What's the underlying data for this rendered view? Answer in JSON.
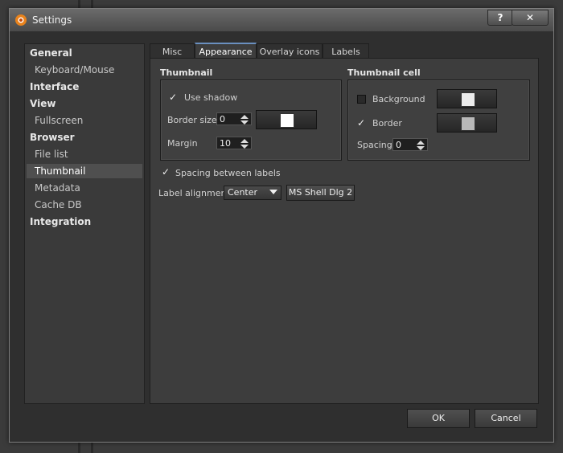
{
  "window": {
    "title": "Settings",
    "help_label": "?",
    "close_label": "✕"
  },
  "sidebar": {
    "items": [
      {
        "label": "General",
        "type": "header"
      },
      {
        "label": "Keyboard/Mouse",
        "type": "sub"
      },
      {
        "label": "Interface",
        "type": "header"
      },
      {
        "label": "View",
        "type": "header"
      },
      {
        "label": "Fullscreen",
        "type": "sub"
      },
      {
        "label": "Browser",
        "type": "header"
      },
      {
        "label": "File list",
        "type": "sub"
      },
      {
        "label": "Thumbnail",
        "type": "sub",
        "selected": true
      },
      {
        "label": "Metadata",
        "type": "sub"
      },
      {
        "label": "Cache DB",
        "type": "sub"
      },
      {
        "label": "Integration",
        "type": "header"
      }
    ]
  },
  "tabs": [
    {
      "label": "Misc"
    },
    {
      "label": "Appearance",
      "active": true
    },
    {
      "label": "Overlay icons"
    },
    {
      "label": "Labels"
    }
  ],
  "thumbnail": {
    "title": "Thumbnail",
    "use_shadow_label": "Use shadow",
    "use_shadow_checked": true,
    "border_size_label": "Border size",
    "border_size_value": "0",
    "border_color": "#ffffff",
    "margin_label": "Margin",
    "margin_value": "10"
  },
  "thumbnail_cell": {
    "title": "Thumbnail cell",
    "background_label": "Background",
    "background_checked": false,
    "background_color": "#ececec",
    "border_label": "Border",
    "border_checked": true,
    "border_color": "#b8b8b8",
    "spacing_label": "Spacing",
    "spacing_value": "0"
  },
  "spacing_between_labels": {
    "label": "Spacing between labels",
    "checked": true
  },
  "label_alignment": {
    "label": "Label alignment",
    "value": "Center",
    "font_button": "MS Shell Dlg 2"
  },
  "footer": {
    "ok_label": "OK",
    "cancel_label": "Cancel"
  }
}
